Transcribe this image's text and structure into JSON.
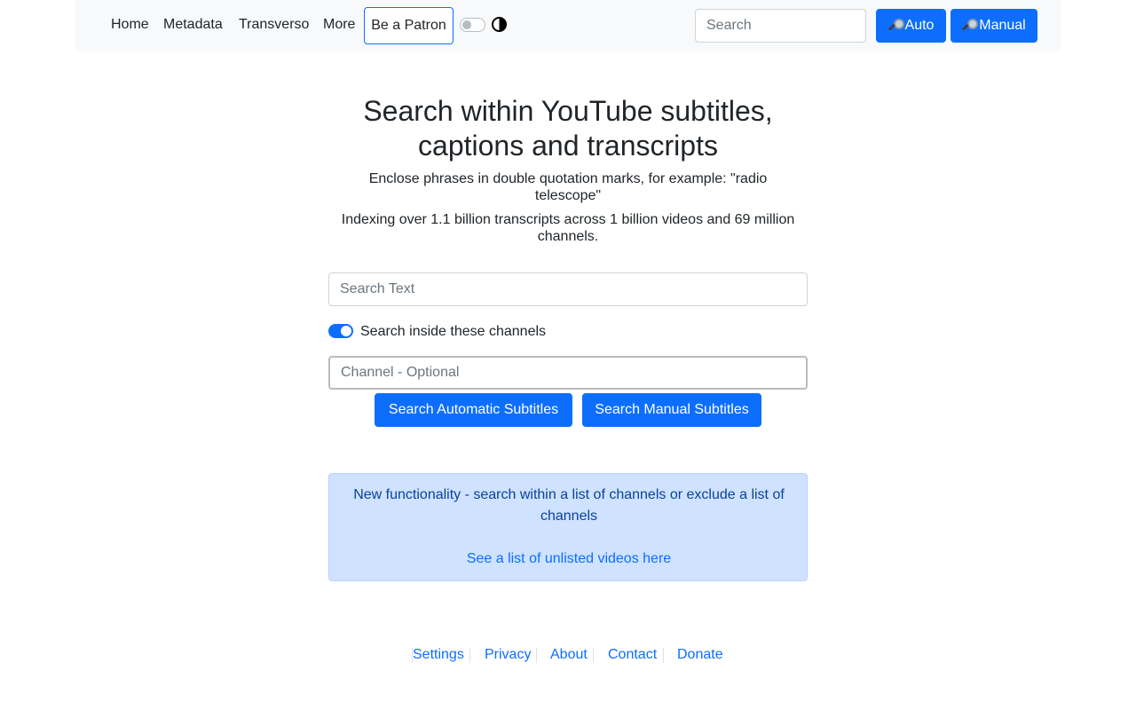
{
  "navbar": {
    "links": [
      {
        "label": "Home"
      },
      {
        "label": "Metadata"
      },
      {
        "label": "Transverso"
      },
      {
        "label": "More"
      }
    ],
    "patron_label": "Be a Patron",
    "theme_toggle_on": false,
    "search_placeholder": "Search",
    "auto_label": "Auto",
    "manual_label": "Manual"
  },
  "main": {
    "title": "Search within YouTube subtitles, captions and transcripts",
    "hint_phrases": "Enclose phrases in double quotation marks, for example: \"radio telescope\"",
    "hint_index": "Indexing over 1.1 billion transcripts across 1 billion videos and 69 million channels.",
    "search_placeholder": "Search Text",
    "channel_toggle_on": true,
    "channel_toggle_label": "Search inside these channels",
    "channel_placeholder": "Channel - Optional",
    "search_auto_label": "Search Automatic Subtitles",
    "search_manual_label": "Search Manual Subtitles"
  },
  "info_box": {
    "text": "New functionality - search within a list of channels or exclude a list of channels",
    "link_label": "See a list of unlisted videos here"
  },
  "footer": {
    "links": [
      {
        "label": "Settings"
      },
      {
        "label": "Privacy"
      },
      {
        "label": "About"
      },
      {
        "label": "Contact"
      },
      {
        "label": "Donate"
      }
    ]
  },
  "colors": {
    "primary": "#0d6efd",
    "navbar_bg": "#f8f9fa",
    "info_bg": "#cfe2ff",
    "info_text": "#084298"
  },
  "icons": {
    "search_button_icon": "magnifier-icon",
    "theme_icon": "contrast-icon"
  }
}
